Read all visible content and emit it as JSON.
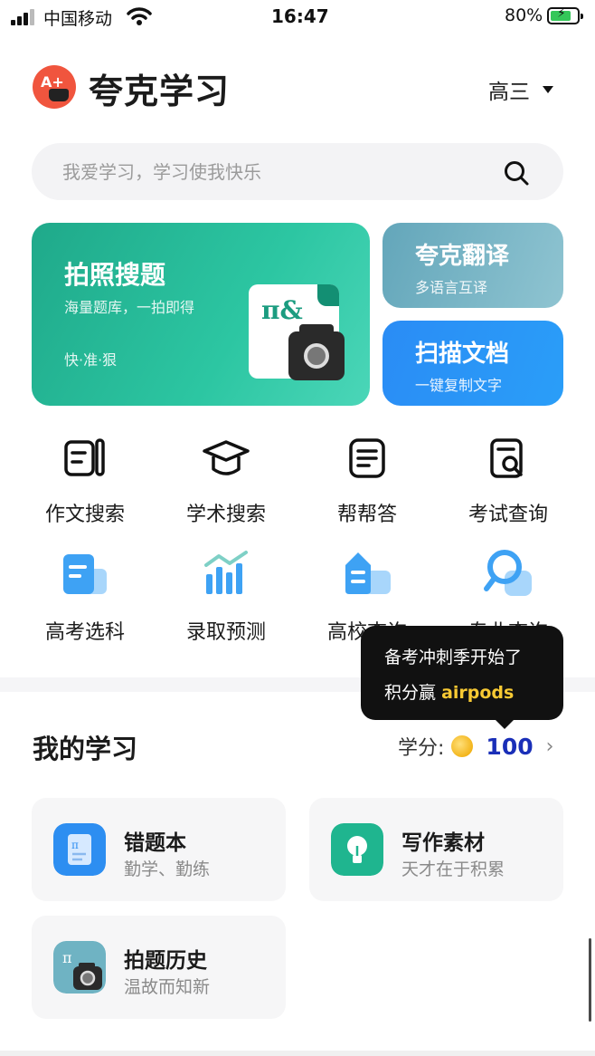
{
  "status_bar": {
    "carrier": "中国移动",
    "time": "16:47",
    "battery": "80%"
  },
  "header": {
    "logo_text": "A+",
    "title": "夸克学习",
    "grade": "高三"
  },
  "search": {
    "placeholder": "我爱学习，学习使我快乐"
  },
  "cards": {
    "photo_search": {
      "title": "拍照搜题",
      "subtitle": "海量题库，一拍即得",
      "tag": "快·准·狠",
      "art_text": "π&"
    },
    "translate": {
      "title": "夸克翻译",
      "subtitle": "多语言互译"
    },
    "scan": {
      "title": "扫描文档",
      "subtitle": "一键复制文字"
    }
  },
  "tools": [
    {
      "label": "作文搜索",
      "icon": "essay-search-icon"
    },
    {
      "label": "学术搜索",
      "icon": "graduation-cap-icon"
    },
    {
      "label": "帮帮答",
      "icon": "help-answer-icon"
    },
    {
      "label": "考试查询",
      "icon": "exam-query-icon"
    },
    {
      "label": "高考选科",
      "icon": "subject-select-icon"
    },
    {
      "label": "录取预测",
      "icon": "admission-chart-icon"
    },
    {
      "label": "高校查询",
      "icon": "university-icon"
    },
    {
      "label": "专业查询",
      "icon": "major-search-icon"
    }
  ],
  "tooltip": {
    "line1": "备考冲刺季开始了",
    "line2_prefix": "积分赢",
    "line2_highlight": "airpods"
  },
  "my_study": {
    "title": "我的学习",
    "credits_label": "学分:",
    "credits_value": "100",
    "tiles": [
      {
        "title": "错题本",
        "subtitle": "勤学、勤练",
        "icon": "mistake-book-icon"
      },
      {
        "title": "写作素材",
        "subtitle": "天才在于积累",
        "icon": "lightbulb-icon"
      },
      {
        "title": "拍题历史",
        "subtitle": "温故而知新",
        "icon": "photo-history-icon"
      }
    ]
  },
  "colors": {
    "green_card": "#2cc6a2",
    "translate_card": "#7ab6c7",
    "scan_card": "#2a93f6",
    "credits_number": "#1a2fb8",
    "tooltip_highlight": "#f7c933"
  }
}
